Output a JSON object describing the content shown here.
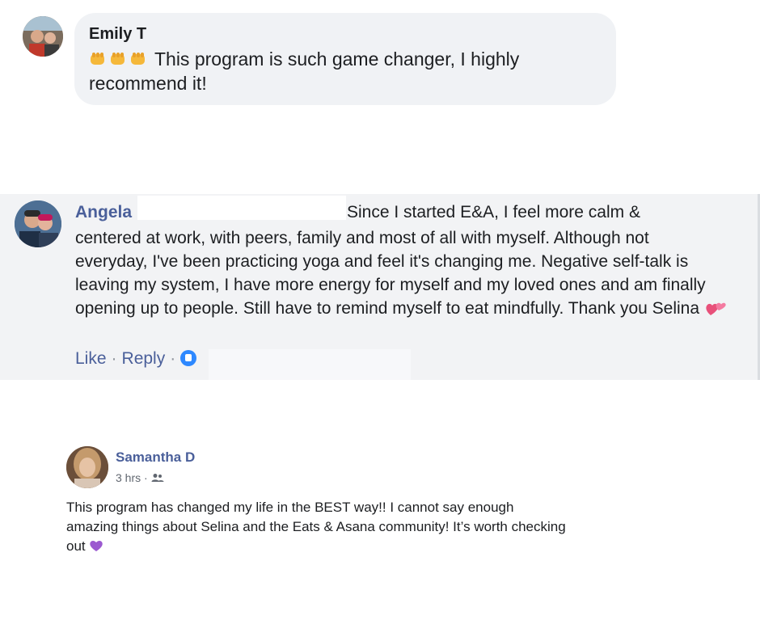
{
  "comments": [
    {
      "name": "Emily T",
      "emoji": [
        "fist-bump-icon",
        "fist-bump-icon",
        "fist-bump-icon"
      ],
      "text": "This program is such game changer, I highly recommend it!"
    },
    {
      "name": "Angela",
      "lead": "Since I started E&A, I feel more calm &",
      "text": "centered at work, with peers, family and most of all with myself. Although not everyday, I've been practicing yoga and feel it's changing me. Negative self-talk is leaving my system, I have more energy for myself and my loved ones and am finally opening up to people. Still have to remind myself to eat mindfully. Thank you Selina",
      "emoji": "two-hearts-icon",
      "actions": {
        "like": "Like",
        "reply": "Reply"
      }
    },
    {
      "name": "Samantha D",
      "time": "3 hrs",
      "audience_icon": "friends-icon",
      "text": "This program has changed my life in the BEST way!! I cannot say enough amazing things about Selina and the Eats & Asana community! It’s worth checking out",
      "emoji": "purple-heart-icon"
    }
  ],
  "colors": {
    "bubble": "#f0f2f5",
    "panel": "#f2f3f5",
    "link": "#4a5f9a",
    "text": "#1c1e21",
    "like_badge": "#2d88ff",
    "purple_heart": "#9b59d0"
  }
}
